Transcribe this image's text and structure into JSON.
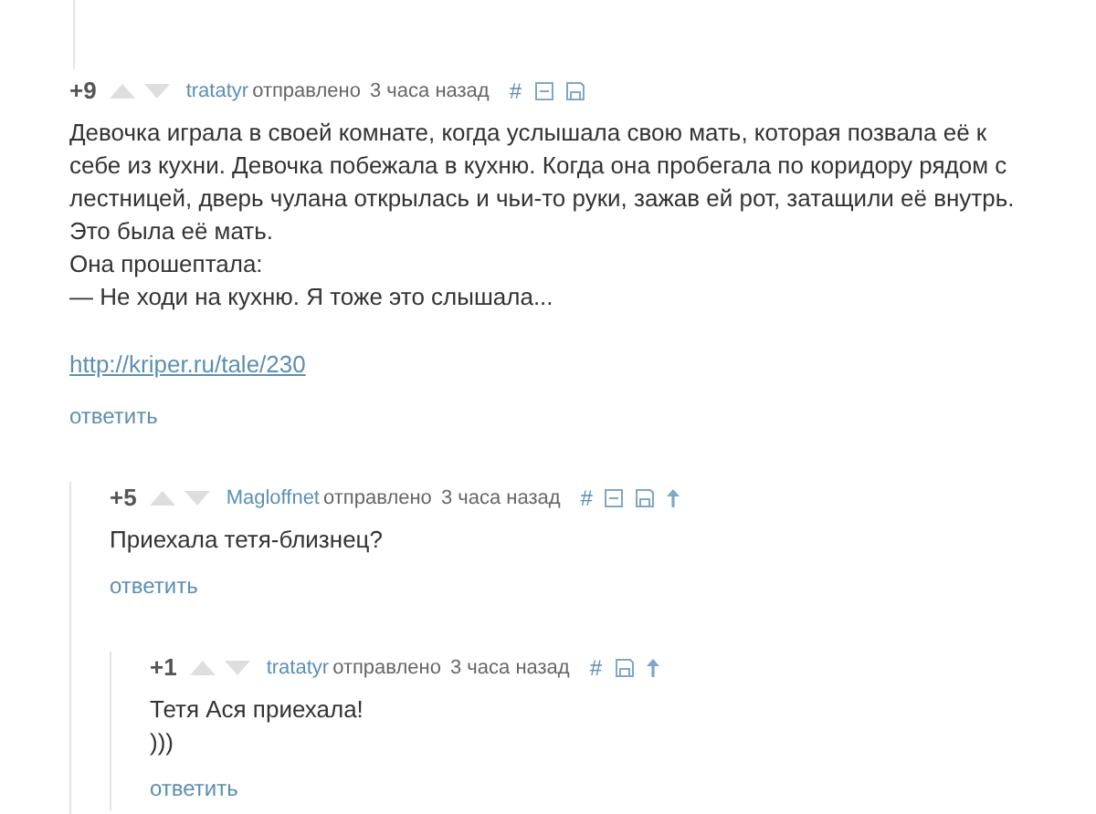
{
  "comments": [
    {
      "rating": "+9",
      "author": "tratatyr",
      "posted": "отправлено",
      "time": "3 часа назад",
      "actions": [
        {
          "kind": "hash",
          "label": "#"
        },
        {
          "kind": "collapse"
        },
        {
          "kind": "save"
        }
      ],
      "body": [
        "Девочка играла в своей комнате, когда услышала свою мать, которая позвала её к себе из кухни. Девочка побежала в кухню. Когда она пробегала по коридору рядом с лестницей, дверь чулана открылась и чьи-то руки, зажав ей рот, затащили её внутрь. Это была её мать.",
        "Она прошептала:",
        "— Не ходи на кухню. Я тоже это слышала..."
      ],
      "link": "http://kriper.ru/tale/230",
      "reply": "ответить",
      "children": [
        {
          "rating": "+5",
          "author": "Magloffnet",
          "posted": "отправлено",
          "time": "3 часа назад",
          "actions": [
            {
              "kind": "hash",
              "label": "#"
            },
            {
              "kind": "collapse"
            },
            {
              "kind": "save"
            },
            {
              "kind": "parent"
            }
          ],
          "body": [
            "Приехала тетя-близнец?"
          ],
          "reply": "ответить",
          "children": [
            {
              "rating": "+1",
              "author": "tratatyr",
              "posted": "отправлено",
              "time": "3 часа назад",
              "actions": [
                {
                  "kind": "hash",
                  "label": "#"
                },
                {
                  "kind": "save"
                },
                {
                  "kind": "parent"
                }
              ],
              "body": [
                "Тетя Ася приехала!",
                ")))"
              ],
              "reply": "ответить"
            }
          ]
        }
      ]
    }
  ]
}
